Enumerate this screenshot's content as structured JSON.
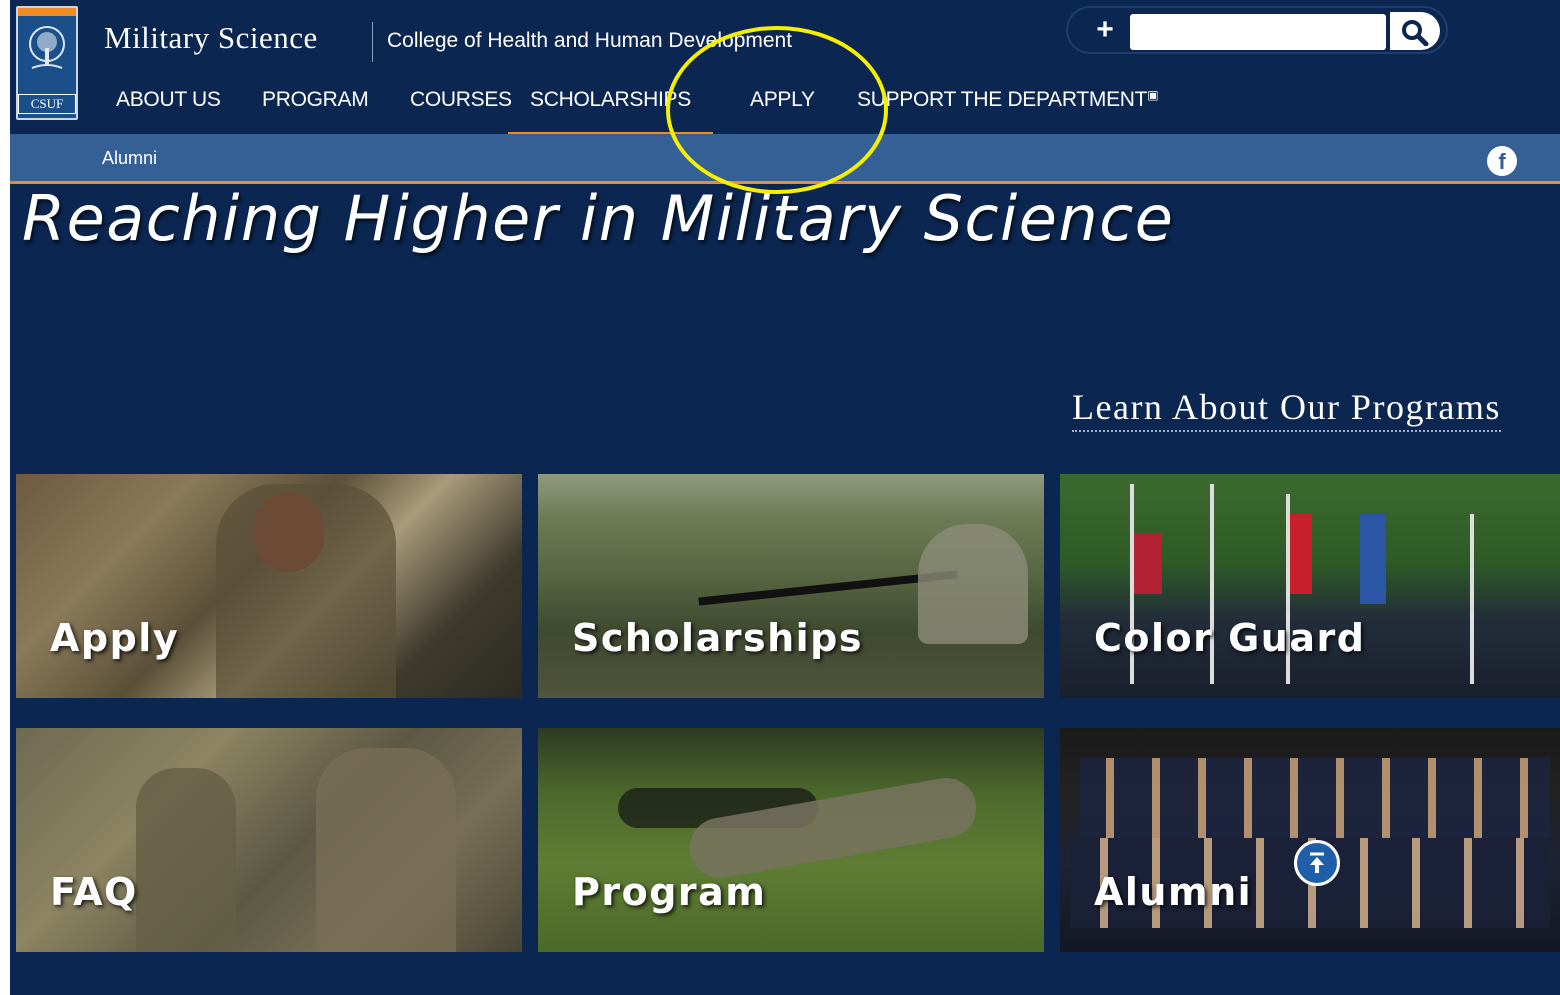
{
  "header": {
    "logo_text": "CSUF",
    "site_title": "Military Science",
    "college": "College of Health and Human Development",
    "search": {
      "placeholder": "",
      "value": ""
    }
  },
  "nav": {
    "items": [
      {
        "label": "ABOUT US"
      },
      {
        "label": "PROGRAM"
      },
      {
        "label": "COURSES"
      },
      {
        "label": "SCHOLARSHIPS",
        "active": true
      },
      {
        "label": "APPLY"
      },
      {
        "label": "SUPPORT THE DEPARTMENT",
        "external": true
      }
    ]
  },
  "subnav": {
    "link": "Alumni"
  },
  "hero": {
    "title": "Reaching Higher in Military Science"
  },
  "programs": {
    "heading": "Learn About Our Programs",
    "tiles": [
      {
        "label": "Apply"
      },
      {
        "label": "Scholarships"
      },
      {
        "label": "Color Guard"
      },
      {
        "label": "FAQ"
      },
      {
        "label": "Program"
      },
      {
        "label": "Alumni"
      }
    ]
  },
  "colors": {
    "navy": "#0b2650",
    "subnav_blue": "#346096",
    "accent_orange": "#f08a24",
    "annotation_yellow": "#f5f000"
  }
}
